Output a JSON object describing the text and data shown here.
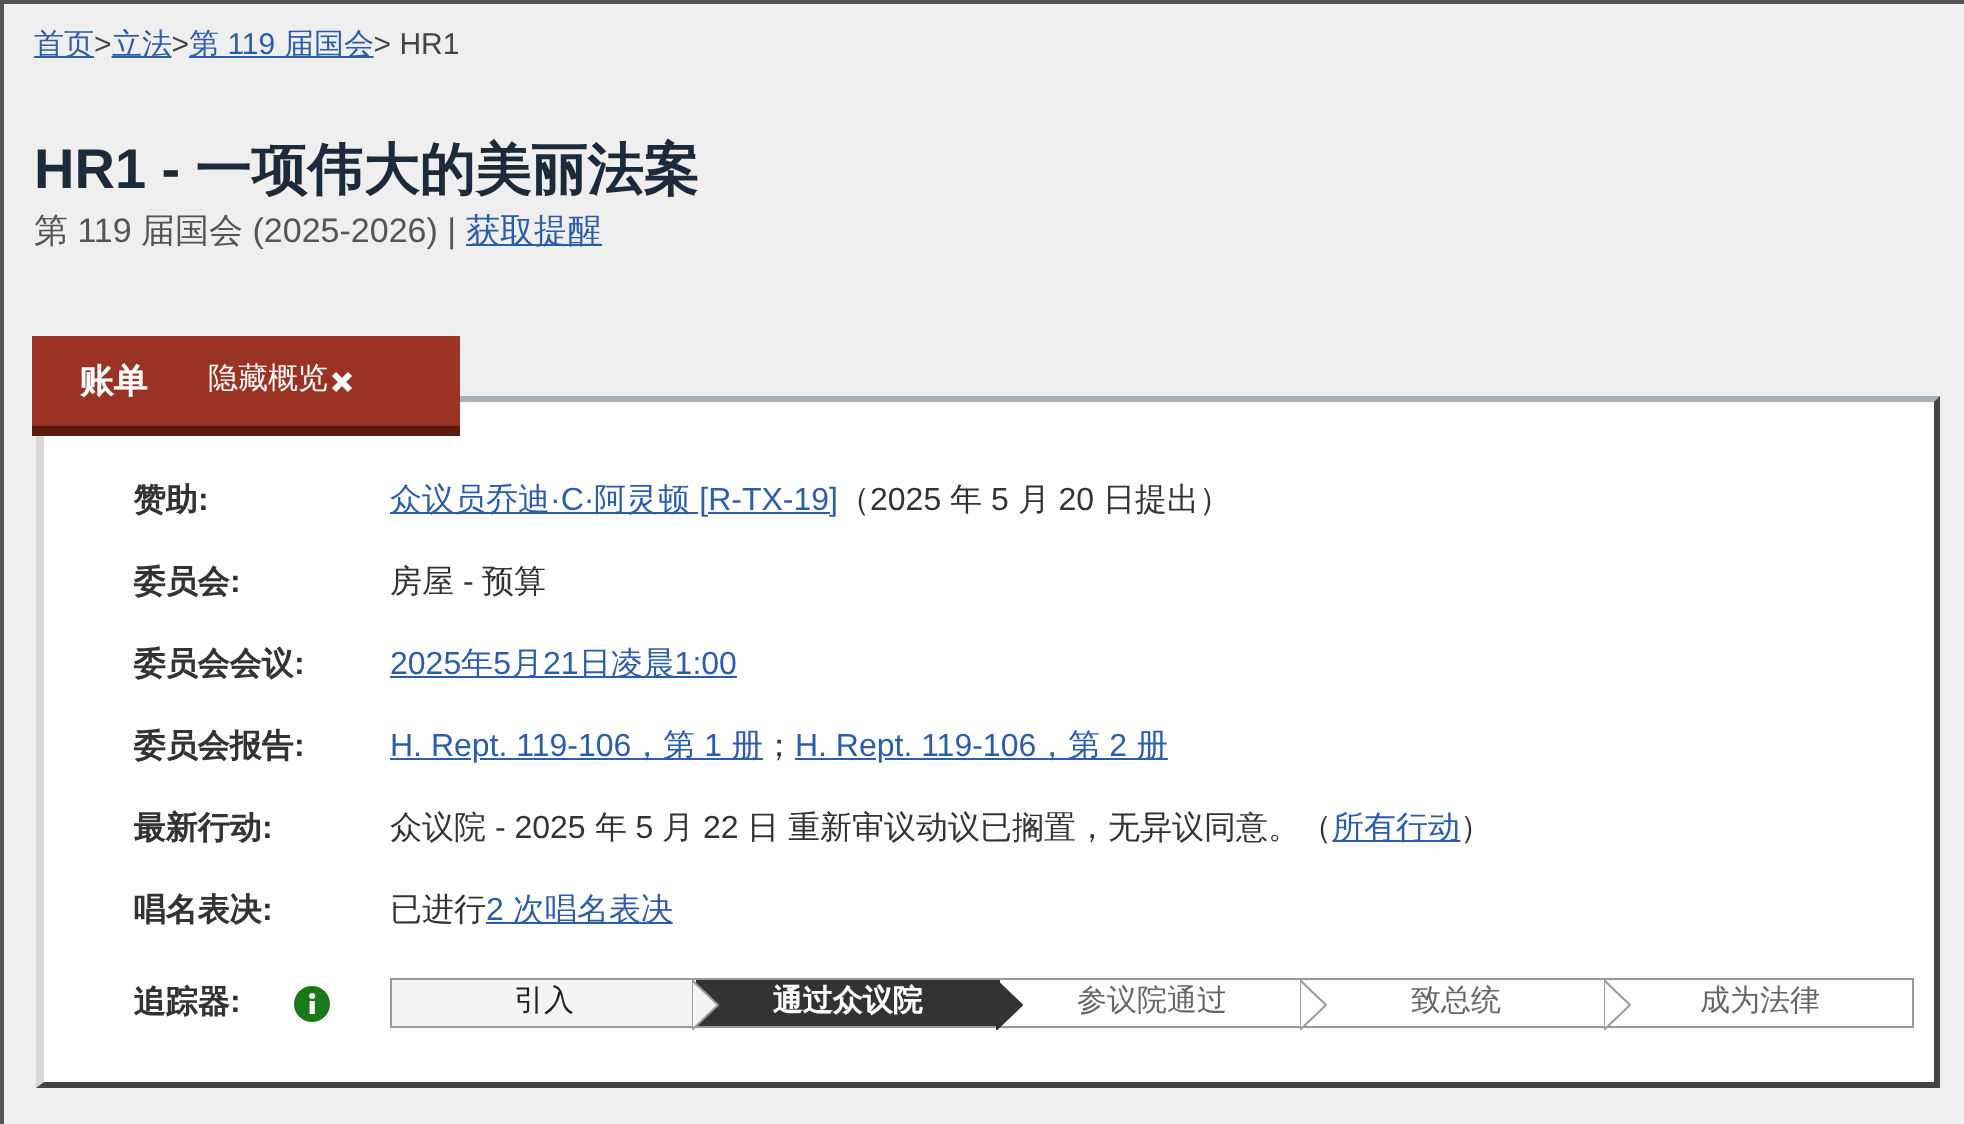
{
  "breadcrumb": [
    {
      "kind": "link",
      "text": "首页"
    },
    {
      "kind": "sep",
      "text": ">"
    },
    {
      "kind": "link",
      "text": "立法"
    },
    {
      "kind": "sep",
      "text": ">"
    },
    {
      "kind": "link",
      "text": "第 119 届国会"
    },
    {
      "kind": "text",
      "text": "> HR1"
    }
  ],
  "title": "HR1 - 一项伟大的美丽法案",
  "subtitle": {
    "text": "第 119 届国会 (2025-2026) |",
    "link": "获取提醒"
  },
  "tabs": [
    {
      "label": "账单",
      "kind": "tab"
    },
    {
      "label": "隐藏概览",
      "kind": "toggle"
    }
  ],
  "fields": [
    {
      "label": "赞助:",
      "parts": [
        {
          "kind": "link",
          "text": "众议员乔迪·C·阿灵顿 [R-TX-19]"
        },
        {
          "kind": "text",
          "text": "（2025 年 5 月 20 日提出）"
        }
      ]
    },
    {
      "label": "委员会:",
      "parts": [
        {
          "kind": "text",
          "text": "房屋 - 预算"
        }
      ]
    },
    {
      "label": "委员会会议:",
      "parts": [
        {
          "kind": "link",
          "text": "2025年5月21日凌晨1:00"
        }
      ]
    },
    {
      "label": "委员会报告:",
      "parts": [
        {
          "kind": "link",
          "text": "H. Rept. 119-106，第 1 册"
        },
        {
          "kind": "text",
          "text": "；"
        },
        {
          "kind": "link",
          "text": "H. Rept. 119-106，第 2 册"
        }
      ]
    },
    {
      "label": "最新行动:",
      "parts": [
        {
          "kind": "text",
          "text": "众议院 - 2025 年 5 月 22 日 重新审议动议已搁置，无异议同意。（"
        },
        {
          "kind": "link",
          "text": "所有行动"
        },
        {
          "kind": "text",
          "text": "）"
        }
      ]
    },
    {
      "label": "唱名表决:",
      "parts": [
        {
          "kind": "text",
          "text": "已进行"
        },
        {
          "kind": "link",
          "text": "2 次唱名表决"
        }
      ]
    }
  ],
  "tracker": {
    "label": "追踪器:",
    "stages": [
      {
        "label": "引入",
        "completed": true,
        "selected": false
      },
      {
        "label": "通过众议院",
        "completed": true,
        "selected": true
      },
      {
        "label": "参议院通过",
        "completed": false,
        "selected": false
      },
      {
        "label": "致总统",
        "completed": false,
        "selected": false
      },
      {
        "label": "成为法律",
        "completed": false,
        "selected": false
      }
    ]
  }
}
